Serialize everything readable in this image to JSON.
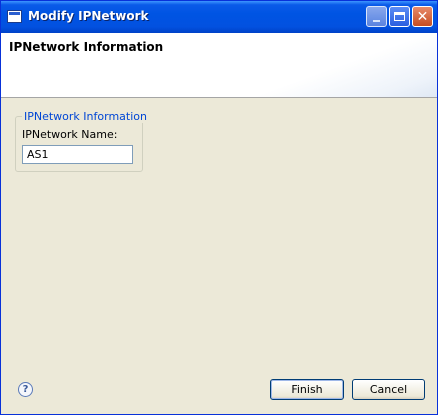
{
  "window": {
    "title": "Modify IPNetwork",
    "icon": "window-app-icon"
  },
  "titlebar_buttons": {
    "minimize_icon": "minimize-icon",
    "maximize_icon": "maximize-icon",
    "close_glyph": "✕"
  },
  "header": {
    "title": "IPNetwork Information"
  },
  "group": {
    "legend": "IPNetwork Information",
    "name_label": "IPNetwork Name:",
    "name_value": "AS1"
  },
  "footer": {
    "help_glyph": "?",
    "finish_label": "Finish",
    "cancel_label": "Cancel"
  },
  "colors": {
    "titlebar": "#0054e3",
    "dialog_bg": "#ece9d8",
    "legend_text": "#0046d5"
  }
}
